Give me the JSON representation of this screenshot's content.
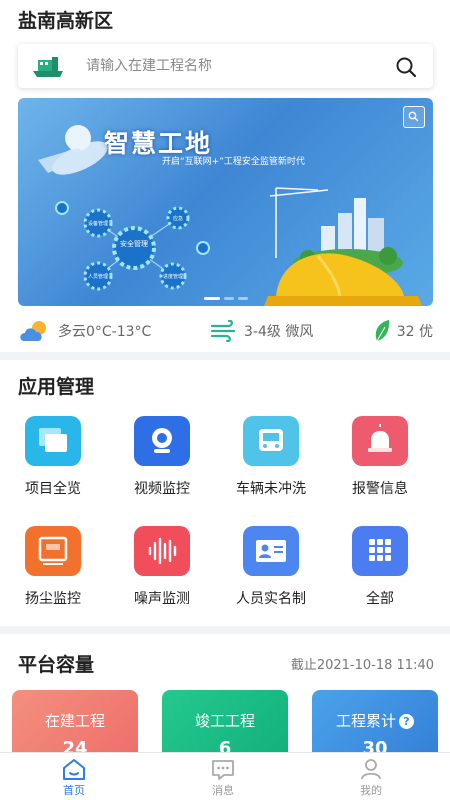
{
  "header": {
    "region": "盐南高新区"
  },
  "search": {
    "placeholder": "请输入在建工程名称",
    "icon": "search-icon"
  },
  "banner": {
    "title": "智慧工地",
    "subtitle": "开启“互联网+”工程安全监管新时代",
    "hub_label": "安全管理",
    "node_labels": [
      "设备管理",
      "应急",
      "人员管理",
      "进度管理"
    ]
  },
  "weather": {
    "condition": "多云0°C-13°C",
    "wind": "3-4级 微风",
    "aqi": "32 优"
  },
  "apps": {
    "title": "应用管理",
    "items": [
      {
        "label": "项目全览",
        "icon": "overview-icon",
        "color": "#29b6e8"
      },
      {
        "label": "视频监控",
        "icon": "camera-icon",
        "color": "#2f6fe6"
      },
      {
        "label": "车辆未冲洗",
        "icon": "vehicle-icon",
        "color": "#4fc3e8"
      },
      {
        "label": "报警信息",
        "icon": "alarm-icon",
        "color": "#ef5b6e"
      },
      {
        "label": "扬尘监控",
        "icon": "dust-icon",
        "color": "#f2712c"
      },
      {
        "label": "噪声监测",
        "icon": "noise-icon",
        "color": "#ef4e5a"
      },
      {
        "label": "人员实名制",
        "icon": "id-card-icon",
        "color": "#4d86ee"
      },
      {
        "label": "全部",
        "icon": "grid-icon",
        "color": "#4b7cf0"
      }
    ]
  },
  "capacity": {
    "title": "平台容量",
    "as_of": "截止2021-10-18 11:40",
    "cards": [
      {
        "label": "在建工程",
        "value": "24",
        "color": "#f07e72"
      },
      {
        "label": "竣工工程",
        "value": "6",
        "color": "#1bbd86"
      },
      {
        "label": "工程累计",
        "value": "30",
        "color": "#3c8fe0",
        "help": "?"
      }
    ]
  },
  "tabbar": {
    "items": [
      {
        "label": "首页",
        "icon": "home-icon",
        "active": true
      },
      {
        "label": "消息",
        "icon": "message-icon",
        "active": false
      },
      {
        "label": "我的",
        "icon": "profile-icon",
        "active": false
      }
    ]
  }
}
